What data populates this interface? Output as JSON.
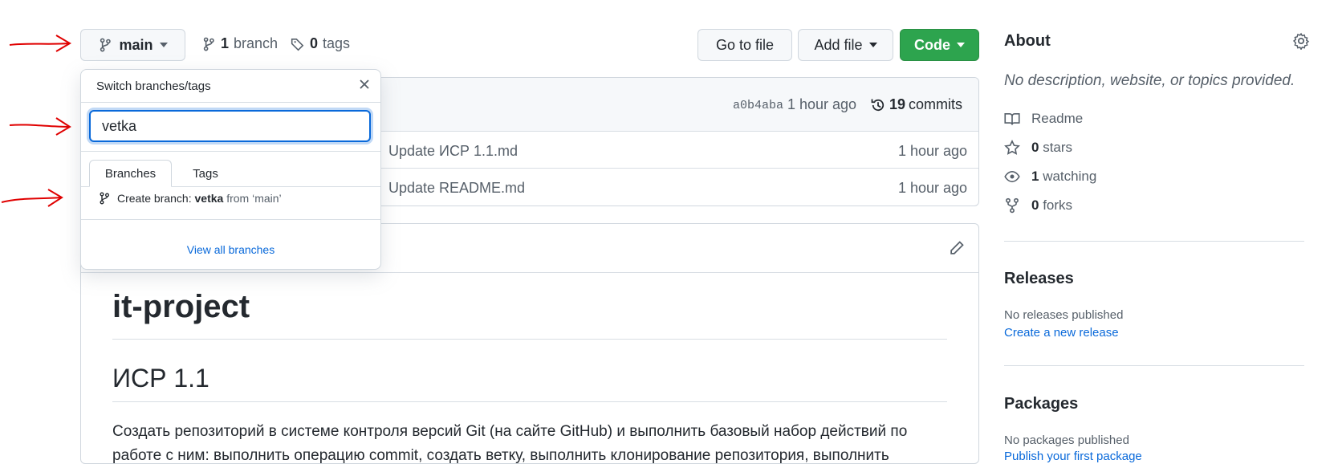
{
  "repo_bar": {
    "branch_button": "main",
    "branch_count": "1",
    "branch_label": "branch",
    "tag_count": "0",
    "tag_label": "tags",
    "go_to_file": "Go to file",
    "add_file": "Add file",
    "code": "Code"
  },
  "commit_bar": {
    "hash": "a0b4aba",
    "time": "1 hour ago",
    "commits_count": "19",
    "commits_label": "commits"
  },
  "files": [
    {
      "message": "Update ИСР 1.1.md",
      "time": "1 hour ago"
    },
    {
      "message": "Update README.md",
      "time": "1 hour ago"
    }
  ],
  "dropdown": {
    "title": "Switch branches/tags",
    "input_value": "vetka",
    "tabs": [
      "Branches",
      "Tags"
    ],
    "create_prefix": "Create branch: ",
    "create_name": "vetka",
    "create_from": " from ‘main’",
    "view_all": "View all branches"
  },
  "readme": {
    "h1": "it-project",
    "h2": "ИСР 1.1",
    "paragraph": "Создать репозиторий в системе контроля версий Git (на сайте GitHub) и выполнить базовый набор действий по работе с ним: выполнить операцию commit, создать ветку, выполнить клонирование репозитория, выполнить"
  },
  "sidebar": {
    "about_title": "About",
    "about_desc": "No description, website, or topics provided.",
    "readme": "Readme",
    "stars_count": "0",
    "stars_label": "stars",
    "watching_count": "1",
    "watching_label": "watching",
    "forks_count": "0",
    "forks_label": "forks",
    "releases_title": "Releases",
    "releases_none": "No releases published",
    "releases_link": "Create a new release",
    "packages_title": "Packages",
    "packages_none": "No packages published",
    "packages_link": "Publish your first package"
  },
  "colors": {
    "annotation_arrow": "#e00000",
    "code_button": "#2da44e",
    "link": "#0969da"
  }
}
